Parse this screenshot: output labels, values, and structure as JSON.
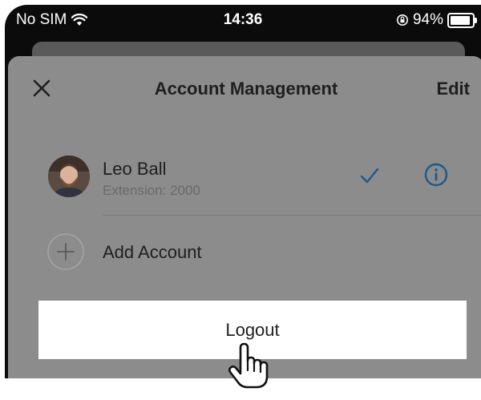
{
  "status_bar": {
    "carrier": "No SIM",
    "time": "14:36",
    "battery_percent": "94%",
    "battery_level": 0.94
  },
  "nav": {
    "title": "Account Management",
    "edit_label": "Edit"
  },
  "account": {
    "name": "Leo Ball",
    "extension": "Extension: 2000"
  },
  "add_account": {
    "label": "Add Account"
  },
  "logout": {
    "label": "Logout"
  },
  "colors": {
    "accent": "#1b5b8c",
    "sheet_dim": "#8c8c8c",
    "button_bg": "#ffffff"
  }
}
